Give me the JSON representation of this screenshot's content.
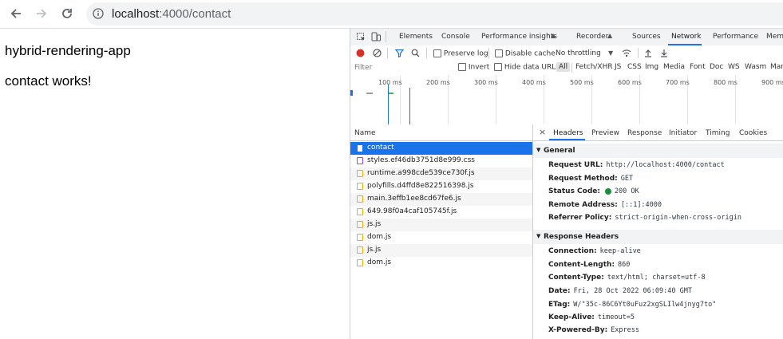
{
  "browser": {
    "url_host": "localhost",
    "url_rest": ":4000/contact"
  },
  "page": {
    "title": "hybrid-rendering-app",
    "message": "contact works!"
  },
  "devtools": {
    "tabs": [
      "Elements",
      "Console",
      "Performance insights",
      "Recorder",
      "Sources",
      "Network",
      "Performance",
      "Memo"
    ],
    "active_tab": "Network",
    "toolbar": {
      "preserve_log": "Preserve log",
      "disable_cache": "Disable cache",
      "throttling": "No throttling"
    },
    "filter": {
      "placeholder": "Filter",
      "invert": "Invert",
      "hide_data_urls": "Hide data URLs",
      "types": [
        "All",
        "Fetch/XHR",
        "JS",
        "CSS",
        "Img",
        "Media",
        "Font",
        "Doc",
        "WS",
        "Wasm",
        "Manifest"
      ]
    },
    "timeline_ticks": [
      "100 ms",
      "200 ms",
      "300 ms",
      "400 ms",
      "500 ms",
      "600 ms",
      "700 ms",
      "800 ms",
      "900 ms"
    ],
    "requests_header": "Name",
    "requests": [
      {
        "name": "contact",
        "kind": "doc"
      },
      {
        "name": "styles.ef46db3751d8e999.css",
        "kind": "css"
      },
      {
        "name": "runtime.a998cde539ce730f.js",
        "kind": "js"
      },
      {
        "name": "polyfills.d4ffd8e822516398.js",
        "kind": "js"
      },
      {
        "name": "main.3effb1ee8cd67fe6.js",
        "kind": "js"
      },
      {
        "name": "649.98f0a4caf105745f.js",
        "kind": "js"
      },
      {
        "name": "js.js",
        "kind": "js"
      },
      {
        "name": "dom.js",
        "kind": "js"
      },
      {
        "name": "js.js",
        "kind": "js"
      },
      {
        "name": "dom.js",
        "kind": "js"
      }
    ],
    "detail_tabs": [
      "Headers",
      "Preview",
      "Response",
      "Initiator",
      "Timing",
      "Cookies"
    ],
    "general": {
      "title": "General",
      "request_url_k": "Request URL:",
      "request_url_v": "http://localhost:4000/contact",
      "method_k": "Request Method:",
      "method_v": "GET",
      "status_k": "Status Code:",
      "status_v": "200 OK",
      "remote_k": "Remote Address:",
      "remote_v": "[::1]:4000",
      "referrer_k": "Referrer Policy:",
      "referrer_v": "strict-origin-when-cross-origin"
    },
    "response_headers": {
      "title": "Response Headers",
      "connection_k": "Connection:",
      "connection_v": "keep-alive",
      "length_k": "Content-Length:",
      "length_v": "860",
      "type_k": "Content-Type:",
      "type_v": "text/html; charset=utf-8",
      "date_k": "Date:",
      "date_v": "Fri, 28 Oct 2022 06:09:40 GMT",
      "etag_k": "ETag:",
      "etag_v": "W/\"35c-86C6Yt0uFuz2xgSLIlw4jnyg7to\"",
      "keepalive_k": "Keep-Alive:",
      "keepalive_v": "timeout=5",
      "powered_k": "X-Powered-By:",
      "powered_v": "Express"
    },
    "colors": {
      "accent": "#1a73e8",
      "record": "#d93025",
      "status_ok": "#1e8e3e",
      "js_icon": "#f9ab00",
      "css_icon": "#a142f4"
    }
  }
}
